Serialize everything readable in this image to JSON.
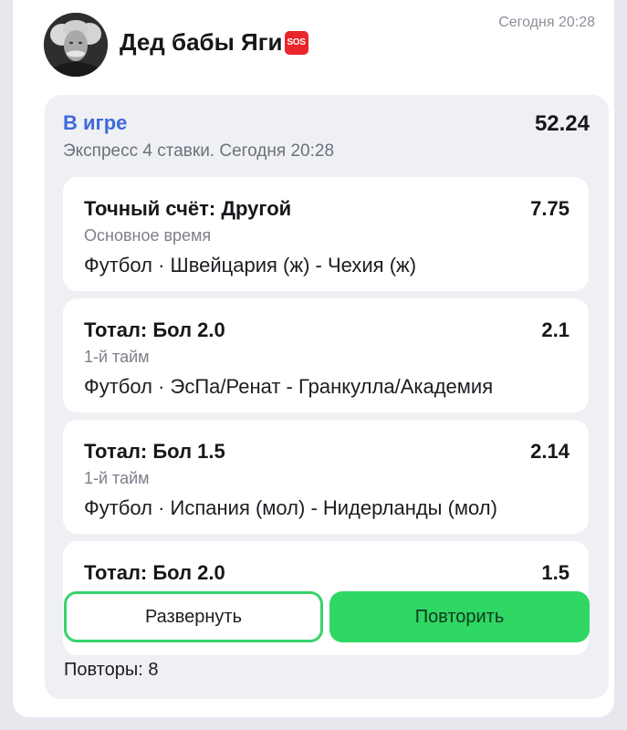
{
  "post": {
    "author": "Дед бабы Яги",
    "author_badge": "SOS",
    "time": "Сегодня 20:28"
  },
  "bet": {
    "status": "В игре",
    "total_odds": "52.24",
    "subtitle": "Экспресс 4 ставки. Сегодня 20:28",
    "events": [
      {
        "market": "Точный счёт: Другой",
        "odds": "7.75",
        "period": "Основное время",
        "match": "Футбол · Швейцария (ж) - Чехия (ж)"
      },
      {
        "market": "Тотал: Бол 2.0",
        "odds": "2.1",
        "period": "1-й тайм",
        "match": "Футбол · ЭсПа/Ренат - Гранкулла/Академия"
      },
      {
        "market": "Тотал: Бол 1.5",
        "odds": "2.14",
        "period": "1-й тайм",
        "match": "Футбол · Испания (мол) - Нидерланды (мол)"
      },
      {
        "market": "Тотал: Бол 2.0",
        "odds": "1.5"
      }
    ],
    "expand_label": "Развернуть",
    "repeat_label": "Повторить",
    "repeats_text": "Повторы: 8"
  },
  "colors": {
    "status_blue": "#3d6bd9",
    "accent_green": "#2fd763",
    "card_bg": "#eff0f4",
    "page_bg": "#e6e8ee"
  },
  "icons": {
    "badge": "sos-badge-icon",
    "avatar": "avatar-photo"
  }
}
